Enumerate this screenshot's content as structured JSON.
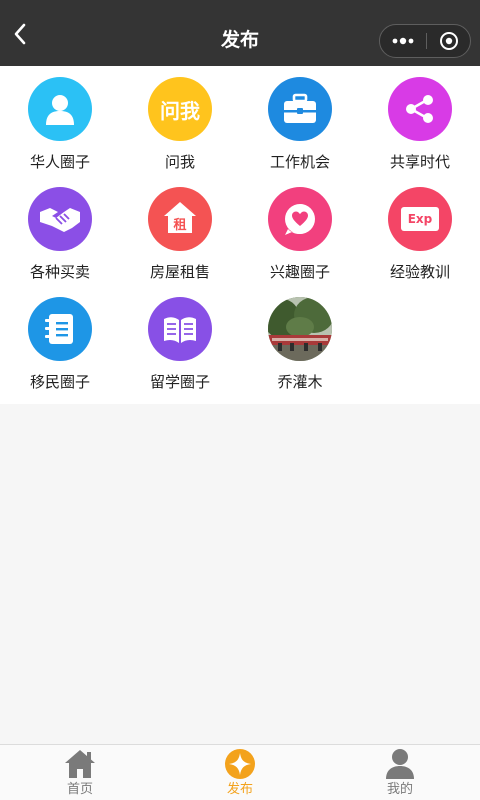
{
  "header": {
    "title": "发布"
  },
  "grid": {
    "items": [
      {
        "label": "华人圈子",
        "icon": "person-icon",
        "color": "#2bc1f5"
      },
      {
        "label": "问我",
        "icon": "ask-me-icon",
        "icon_text": "问我",
        "color": "#ffc41d"
      },
      {
        "label": "工作机会",
        "icon": "briefcase-icon",
        "color": "#1e8ae0"
      },
      {
        "label": "共享时代",
        "icon": "share-icon",
        "color": "#d83be6"
      },
      {
        "label": "各种买卖",
        "icon": "handshake-icon",
        "color": "#8b4fe6"
      },
      {
        "label": "房屋租售",
        "icon": "house-rent-icon",
        "icon_text": "租",
        "color": "#f45353"
      },
      {
        "label": "兴趣圈子",
        "icon": "heart-bubble-icon",
        "color": "#f2407e"
      },
      {
        "label": "经验教训",
        "icon": "exp-icon",
        "icon_text": "Exp",
        "color": "#f44566"
      },
      {
        "label": "移民圈子",
        "icon": "notebook-icon",
        "color": "#1e96e6"
      },
      {
        "label": "留学圈子",
        "icon": "open-book-icon",
        "color": "#8850e6"
      },
      {
        "label": "乔灌木",
        "icon": "avatar-photo",
        "color": "#4d6a3a"
      }
    ]
  },
  "tabbar": {
    "tabs": [
      {
        "label": "首页",
        "icon": "home-icon"
      },
      {
        "label": "发布",
        "icon": "publish-icon"
      },
      {
        "label": "我的",
        "icon": "profile-icon"
      }
    ],
    "active_color": "#f3a21c",
    "inactive_color": "#7a7a7a"
  }
}
